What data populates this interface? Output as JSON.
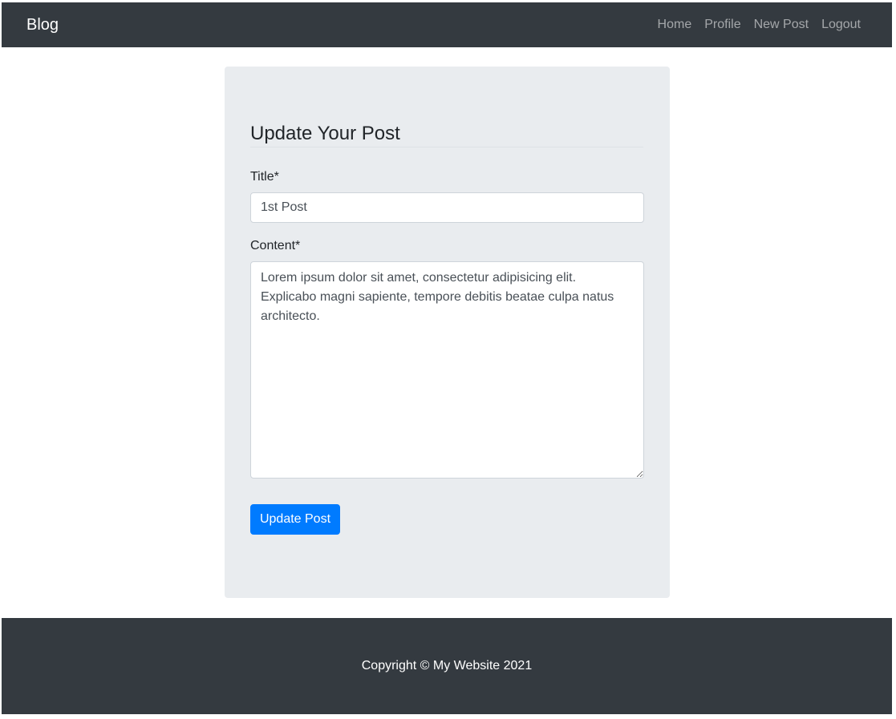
{
  "nav": {
    "brand": "Blog",
    "links": [
      "Home",
      "Profile",
      "New Post",
      "Logout"
    ]
  },
  "form": {
    "legend": "Update Your Post",
    "title_label": "Title*",
    "title_value": "1st Post",
    "content_label": "Content*",
    "content_value": "Lorem ipsum dolor sit amet, consectetur adipisicing elit. Explicabo magni sapiente, tempore debitis beatae culpa natus architecto.",
    "submit_label": "Update Post"
  },
  "footer": {
    "copyright": "Copyright © My Website 2021"
  },
  "colors": {
    "navbar": "#343a40",
    "card": "#e9ecef",
    "primary": "#007bff"
  }
}
